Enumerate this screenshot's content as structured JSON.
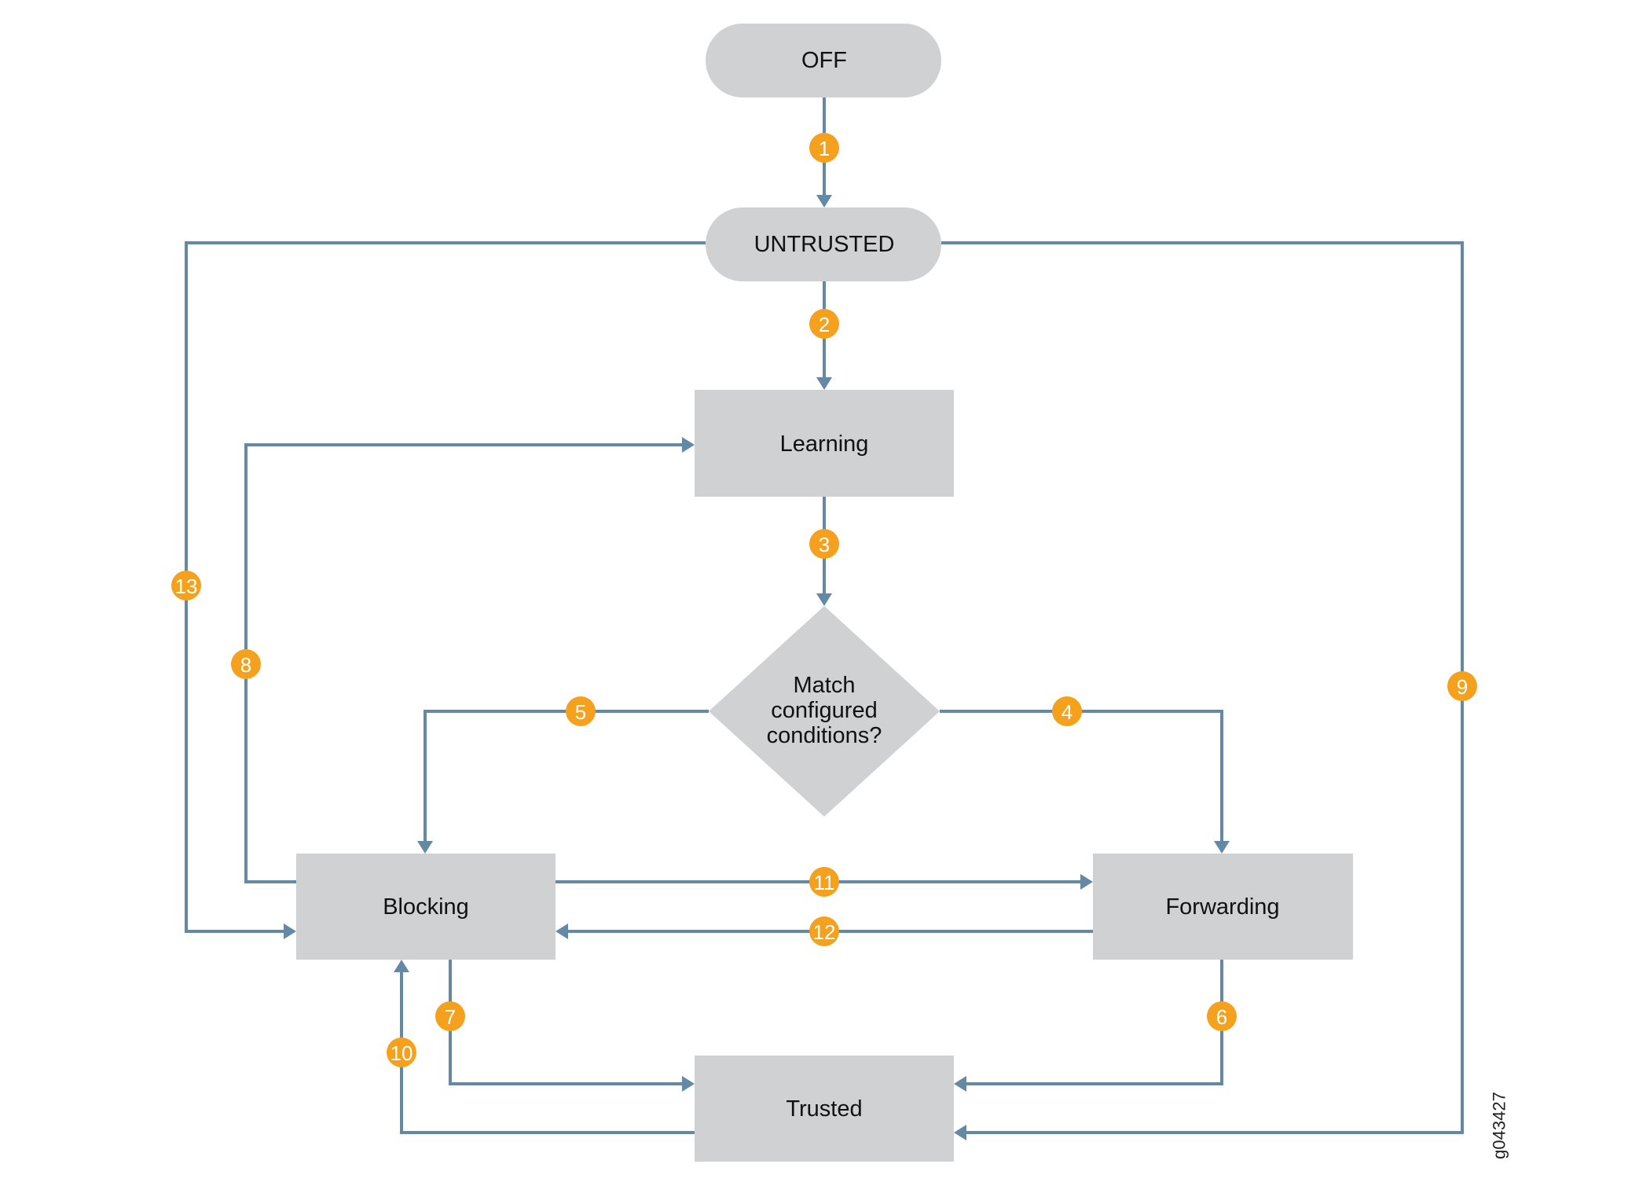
{
  "diagram": {
    "type": "state-flowchart",
    "colors": {
      "node_fill": "#d0d1d3",
      "edge": "#6389a5",
      "badge": "#f5a11d",
      "badge_text": "#ffffff",
      "label_text": "#111111"
    },
    "nodes": {
      "off": {
        "label": "OFF",
        "shape": "pill"
      },
      "untrusted": {
        "label": "UNTRUSTED",
        "shape": "pill"
      },
      "learning": {
        "label": "Learning",
        "shape": "rect"
      },
      "decision": {
        "lines": [
          "Match",
          "configured",
          "conditions?"
        ],
        "shape": "diamond"
      },
      "blocking": {
        "label": "Blocking",
        "shape": "rect"
      },
      "forwarding": {
        "label": "Forwarding",
        "shape": "rect"
      },
      "trusted": {
        "label": "Trusted",
        "shape": "rect"
      }
    },
    "edges": [
      {
        "id": "1",
        "from": "off",
        "to": "untrusted",
        "badge": "1"
      },
      {
        "id": "2",
        "from": "untrusted",
        "to": "learning",
        "badge": "2"
      },
      {
        "id": "3",
        "from": "learning",
        "to": "decision",
        "badge": "3"
      },
      {
        "id": "4",
        "from": "decision",
        "to": "forwarding",
        "badge": "4"
      },
      {
        "id": "5",
        "from": "decision",
        "to": "blocking",
        "badge": "5"
      },
      {
        "id": "6",
        "from": "forwarding",
        "to": "trusted",
        "badge": "6"
      },
      {
        "id": "7",
        "from": "blocking",
        "to": "trusted",
        "badge": "7"
      },
      {
        "id": "8",
        "from": "blocking",
        "to": "learning",
        "badge": "8"
      },
      {
        "id": "9",
        "from": "untrusted",
        "to": "trusted",
        "badge": "9"
      },
      {
        "id": "10",
        "from": "trusted",
        "to": "blocking",
        "badge": "10"
      },
      {
        "id": "11",
        "from": "blocking",
        "to": "forwarding",
        "badge": "11"
      },
      {
        "id": "12",
        "from": "forwarding",
        "to": "blocking",
        "badge": "12"
      },
      {
        "id": "13",
        "from": "untrusted",
        "to": "blocking",
        "badge": "13"
      }
    ],
    "figure_id": "g043427"
  }
}
